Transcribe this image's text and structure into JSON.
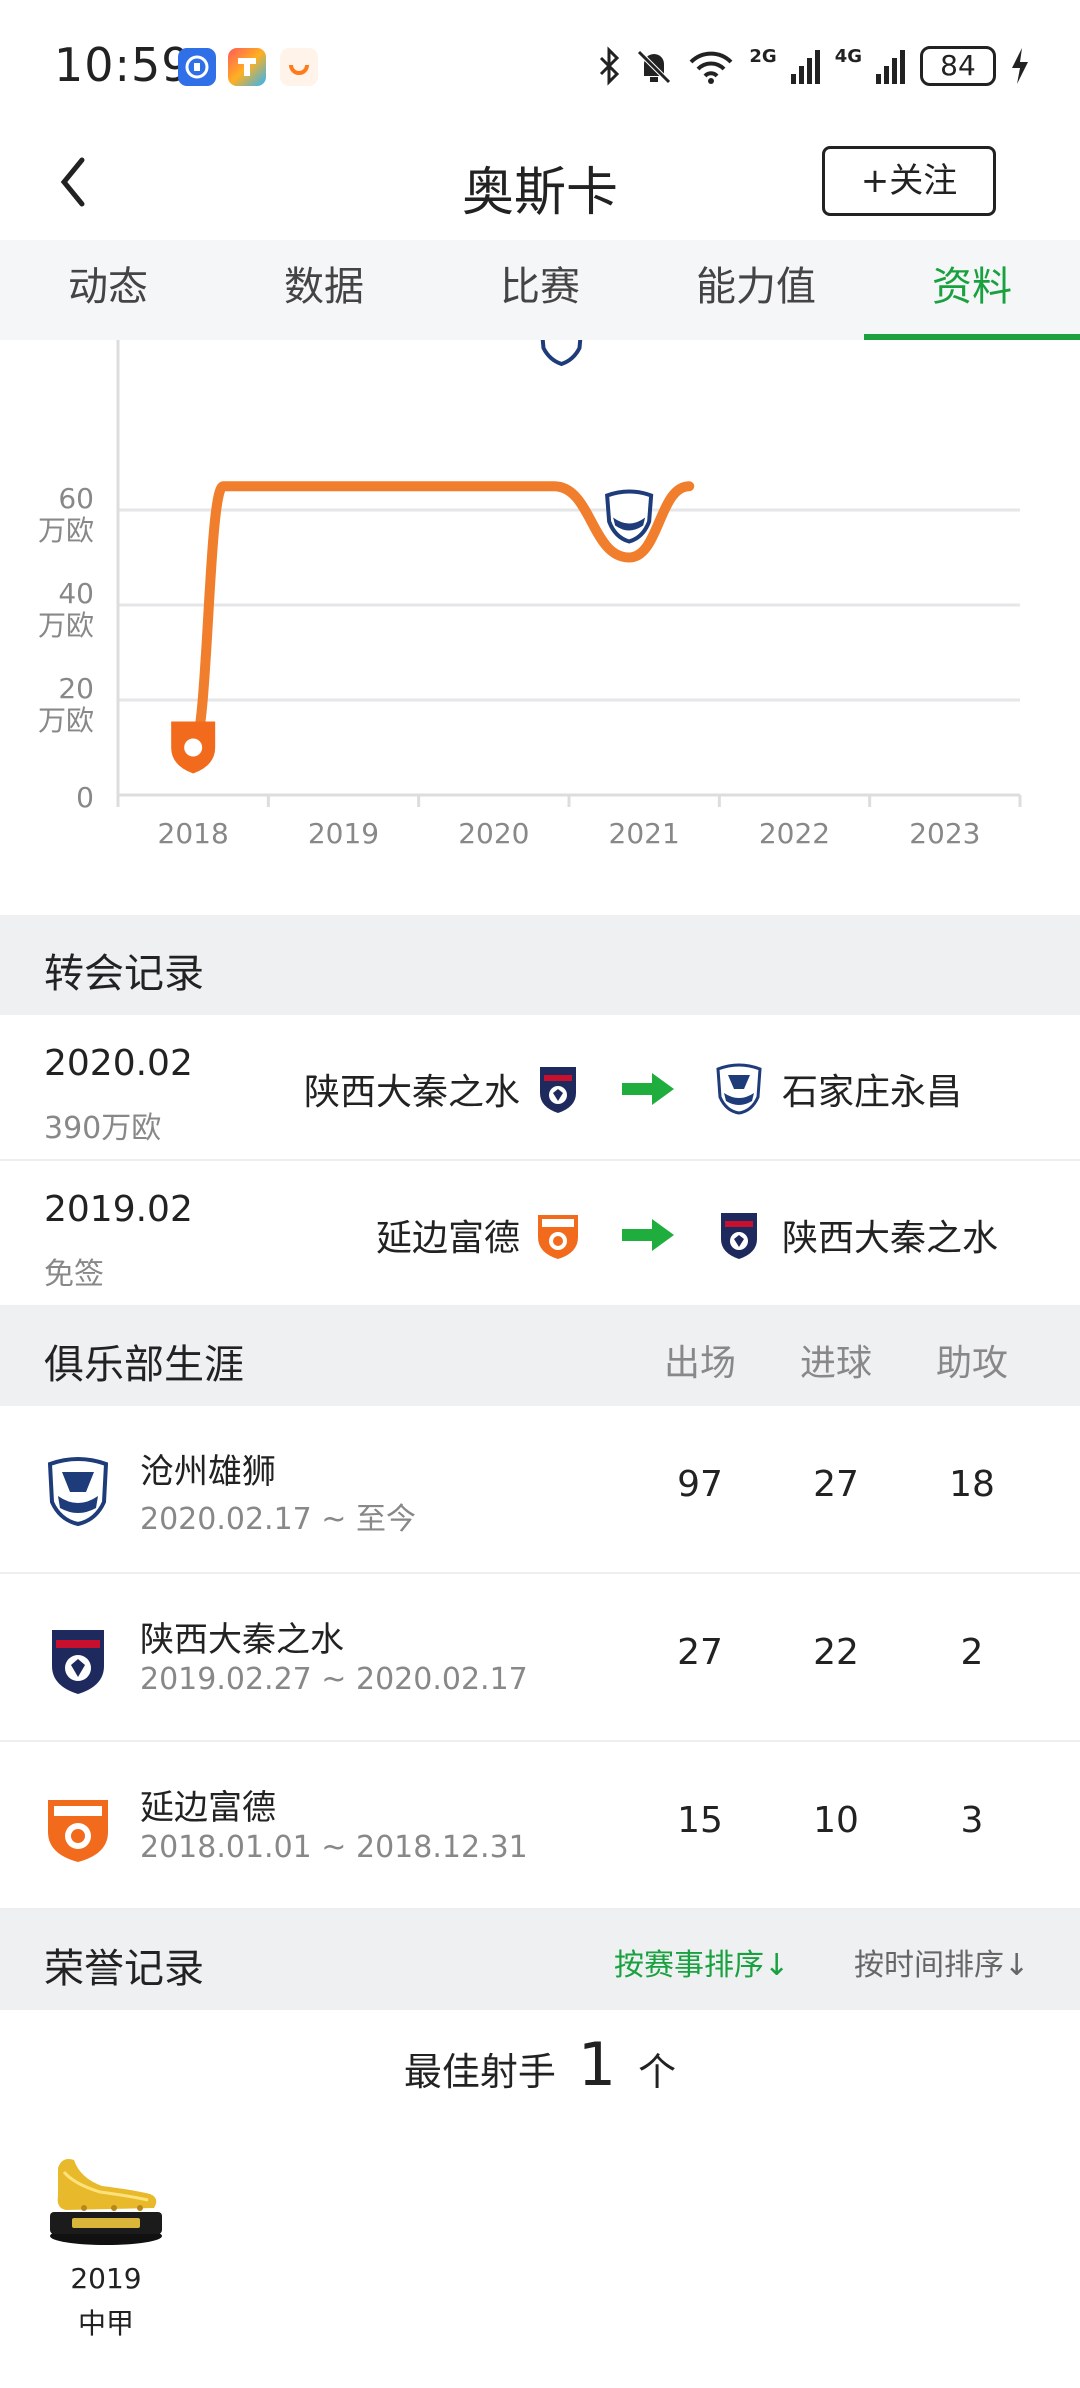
{
  "status_bar": {
    "time": "10:59",
    "battery": "84",
    "signal1": "2G",
    "signal2": "4G"
  },
  "header": {
    "title": "奥斯卡",
    "follow_label": "+关注"
  },
  "tabs": [
    {
      "label": "动态"
    },
    {
      "label": "数据"
    },
    {
      "label": "比赛"
    },
    {
      "label": "能力值"
    },
    {
      "label": "资料",
      "active": true
    }
  ],
  "chart_data": {
    "type": "line",
    "y_ticks": [
      "0",
      "20\n万欧",
      "40\n万欧",
      "60\n万欧"
    ],
    "y_tick_values": [
      0,
      20,
      40,
      60
    ],
    "x_labels": [
      "2018",
      "2019",
      "2020",
      "2021",
      "2022",
      "2023"
    ],
    "series": [
      {
        "x": [
          2018,
          2018.2,
          2020.4,
          2020.9,
          2021.3
        ],
        "y": [
          10,
          65,
          65,
          50,
          65
        ]
      }
    ],
    "visible_ylim": [
      0,
      60
    ],
    "color": "#f07e2c",
    "grid": true
  },
  "transfers": {
    "title": "转会记录",
    "rows": [
      {
        "date": "2020.02",
        "fee": "390万欧",
        "from": "陕西大秦之水",
        "to": "石家庄永昌"
      },
      {
        "date": "2019.02",
        "fee": "免签",
        "from": "延边富德",
        "to": "陕西大秦之水"
      }
    ]
  },
  "career": {
    "title": "俱乐部生涯",
    "headers": {
      "apps": "出场",
      "goals": "进球",
      "assists": "助攻"
    },
    "rows": [
      {
        "club": "沧州雄狮",
        "period": "2020.02.17 ~ 至今",
        "apps": "97",
        "goals": "27",
        "assists": "18"
      },
      {
        "club": "陕西大秦之水",
        "period": "2019.02.27 ~ 2020.02.17",
        "apps": "27",
        "goals": "22",
        "assists": "2"
      },
      {
        "club": "延边富德",
        "period": "2018.01.01 ~ 2018.12.31",
        "apps": "15",
        "goals": "10",
        "assists": "3"
      }
    ]
  },
  "honours": {
    "title": "荣誉记录",
    "sort_by_competition": "按赛事排序↓",
    "sort_by_time": "按时间排序↓",
    "label": "最佳射手",
    "count": "1",
    "unit": "个",
    "items": [
      {
        "year": "2019",
        "league": "中甲"
      }
    ]
  },
  "colors": {
    "accent": "#1aa13f",
    "chart_line": "#f07e2c"
  }
}
